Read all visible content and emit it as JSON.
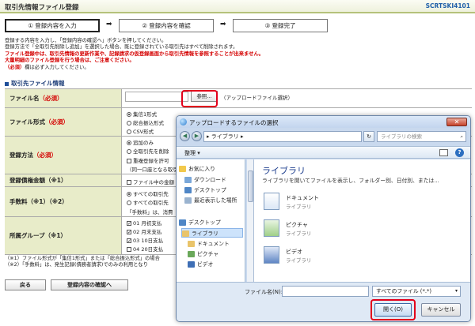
{
  "header": {
    "title": "取引先情報ファイル登録",
    "screen_code": "SCRTSKI4101"
  },
  "steps": [
    {
      "label": "① 登録内容を入力"
    },
    {
      "label": "② 登録内容を確認"
    },
    {
      "label": "③ 登録完了"
    }
  ],
  "step_arrow": "➡",
  "messages": {
    "line1": "登録する内容を入力し、「登録内容の確認へ」ボタンを押してください。",
    "line2": "登録方法で「全取引先削除し追加」を選択した場合、既に登録されている取引先はすべて削除されます。",
    "warn1": "ファイル登録中は、取引先情報の更新作業や、記録請求の仮登録画面から取引先情報を参照することが出来ません。",
    "warn2": "大量明細のファイル登録を行う場合は、ご注意ください。",
    "req_tag": "（必須）",
    "req_rest": "欄は必ず入力してください。"
  },
  "section_title": "取引先ファイル情報",
  "form": {
    "file_name": {
      "label": "ファイル名",
      "req": "（必須）",
      "browse_label": "参照...",
      "hint": "（アップロードファイル選択）"
    },
    "file_format": {
      "label": "ファイル形式",
      "req": "（必須）",
      "options": [
        "集信1形式",
        "総合振込形式",
        "CSV形式"
      ],
      "selected": 0
    },
    "reg_method": {
      "label": "登録方法",
      "req": "（必須）",
      "options": [
        "追加のみ",
        "全取引先を削除"
      ],
      "selected": 0,
      "extra_checkbox": "重複登録を許可",
      "extra_note": "（同一口座となる取引"
    },
    "amount": {
      "label": "登録債権金額（※1）",
      "checkbox": "ファイル中の金額"
    },
    "fee": {
      "label": "手数料（※1）（※2）",
      "options": [
        "すべての取引先",
        "すべての取引先"
      ],
      "selected": 0,
      "note": "「手数料」は、消費"
    },
    "group": {
      "label": "所属グループ（※1）",
      "items": [
        {
          "text": "01 月初支払",
          "checked": true
        },
        {
          "text": "02 月末支払",
          "checked": true
        },
        {
          "text": "03 10日支払",
          "checked": true
        },
        {
          "text": "04 20日支払",
          "checked": false
        }
      ]
    }
  },
  "notes": {
    "n1": "（※1）ファイル形式が「集信1形式」または「総合振込形式」の場合",
    "n2": "（※2）「手数料」は、発生記録(債務者請求)でのみの利用となり"
  },
  "buttons": {
    "back": "戻る",
    "confirm": "登録内容の確認へ"
  },
  "dialog": {
    "title": "アップロードするファイルの選択",
    "close": "✕",
    "back_arrow": "◀",
    "forward_arrow": "▶",
    "address": "▸ ライブラリ ▸",
    "refresh": "↻",
    "search_placeholder": "ライブラリの検索",
    "search_icon": "⌕",
    "organize": "整理 ▾",
    "help": "?",
    "tree": [
      "お気に入り",
      "ダウンロード",
      "デスクトップ",
      "最近表示した場所",
      "デスクトップ",
      "ライブラリ",
      "ドキュメント",
      "ピクチャ",
      "ビデオ"
    ],
    "library_title": "ライブラリ",
    "library_sub": "ライブラリを開いてファイルを表示し、フォルダー別、日付別、または...",
    "libraries": [
      {
        "name": "ドキュメント",
        "kind": "ライブラリ"
      },
      {
        "name": "ピクチャ",
        "kind": "ライブラリ"
      },
      {
        "name": "ビデオ",
        "kind": "ライブラリ"
      }
    ],
    "filename_label": "ファイル名(N):",
    "filename_value": "",
    "filter": "すべてのファイル (*.*)",
    "filter_arrow": "▾",
    "open": "開く(O)",
    "cancel": "キャンセル"
  },
  "colors": {
    "label_bg": "#e8ecc9",
    "accent_red": "#e3001b",
    "title_blue": "#1f5fa8"
  }
}
